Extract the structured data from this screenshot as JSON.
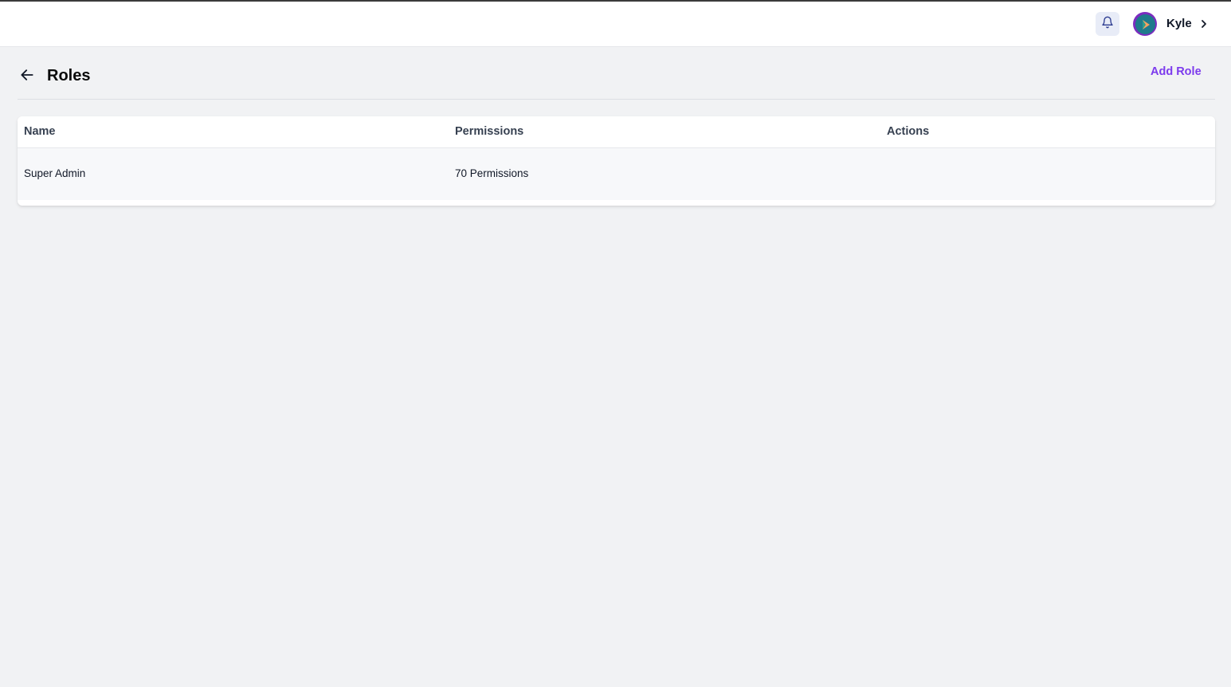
{
  "header": {
    "user_name": "Kyle",
    "icons": [
      "bell-icon",
      "avatar",
      "chevron-right-icon"
    ]
  },
  "page": {
    "title": "Roles",
    "back_icon": "arrow-left-icon",
    "add_button_label": "Add Role"
  },
  "table": {
    "columns": [
      "Name",
      "Permissions",
      "Actions"
    ],
    "rows": [
      {
        "name": "Super Admin",
        "permissions": "70 Permissions",
        "actions": ""
      }
    ]
  },
  "colors": {
    "accent": "#7c3aed",
    "background": "#f1f2f4",
    "header_bg": "#ffffff"
  }
}
